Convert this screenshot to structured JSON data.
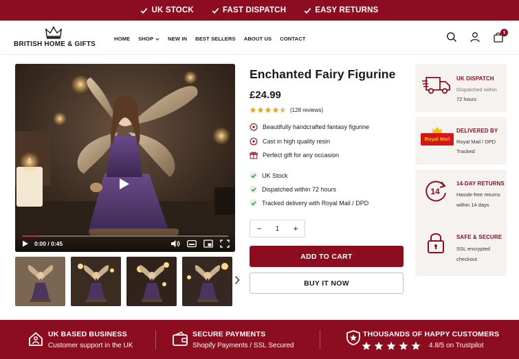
{
  "topbar": {
    "perks": [
      "UK STOCK",
      "FAST DISPATCH",
      "EASY RETURNS"
    ]
  },
  "header": {
    "logo_text": "BRITISH HOME & GIFTS",
    "nav": [
      "HOME",
      "SHOP",
      "NEW IN",
      "BEST SELLERS",
      "ABOUT US",
      "CONTACT"
    ],
    "cart_count": "1",
    "icons": [
      "search-icon",
      "user-icon",
      "cart-icon"
    ]
  },
  "media": {
    "time": "0:00 / 0:45",
    "progress": 0.08
  },
  "product": {
    "title": "Enchanted Fairy Figurine",
    "price": "£24.99",
    "rating": 4.5,
    "reviews": "(128 reviews)",
    "features": [
      "Beautifully handcrafted fantasy figurine",
      "Cast in high quality resin",
      "Perfect gift for any occasion"
    ],
    "checks": [
      "UK Stock",
      "Dispatched within 72 hours",
      "Tracked delivery with Royal Mail / DPD"
    ],
    "quantity": "1",
    "qty_minus": "−",
    "qty_plus": "+",
    "add_to_cart": "ADD TO CART",
    "buy_now": "BUY IT NOW"
  },
  "side_cards": {
    "dispatch": {
      "title": "UK DISPATCH",
      "line1": "Dispatched within",
      "line2": "72 hours"
    },
    "delivered": {
      "title": "DELIVERED BY",
      "line1": "Royal Mail / DPD",
      "line2": "Tracked",
      "logo_text": "Royal Mail"
    },
    "returns": {
      "title": "14-DAY RETURNS",
      "line1": "Hassle-free returns",
      "line2": "within 14 days",
      "badge": "14"
    },
    "secure": {
      "title": "SAFE & SECURE",
      "line1": "SSL encrypted",
      "line2": "checkout"
    }
  },
  "bottombar": {
    "items": [
      {
        "title": "UK BASED BUSINESS",
        "sub": "Customer support in the UK"
      },
      {
        "title": "SECURE PAYMENTS",
        "sub": "Shopify Payments / SSL Secured"
      },
      {
        "title": "THOUSANDS OF HAPPY CUSTOMERS",
        "sub": "4.8/5 on Trustpilot"
      }
    ]
  },
  "colors": {
    "brand": "#8b0d1f",
    "star": "#e8a820",
    "check": "#2e8b3a"
  }
}
